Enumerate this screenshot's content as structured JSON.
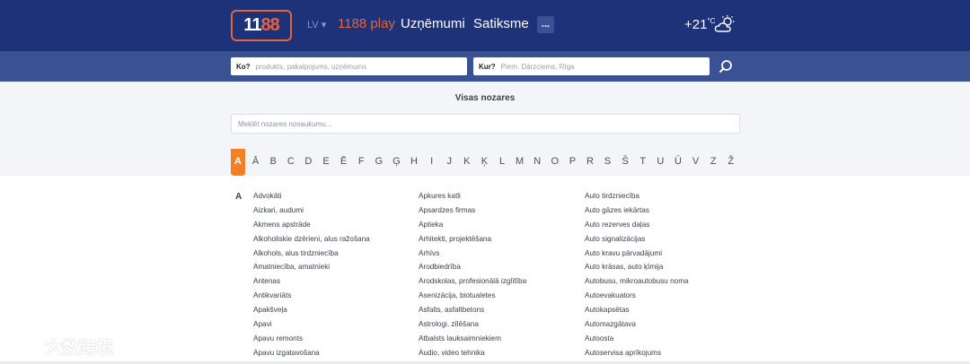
{
  "header": {
    "logo_part1": "11",
    "logo_part2": "88",
    "lang": "LV ▾",
    "nav": {
      "play": "1188 play",
      "companies": "Uzņēmumi",
      "contacts": "Satiksme",
      "more": "..."
    },
    "weather": {
      "temp": "+21",
      "unit": "°C",
      "icon": "cloud-sun-icon"
    }
  },
  "search": {
    "who_label": "Ko?",
    "who_placeholder": "produkts, pakalpojums, uzņēmums",
    "where_label": "Kur?",
    "where_placeholder": "Piem. Dārzciems, Rīga"
  },
  "main": {
    "title": "Visas nozares",
    "filter_placeholder": "Meklēt nozares nosaukumu...",
    "alphabet": [
      "A",
      "Ā",
      "B",
      "C",
      "D",
      "E",
      "Ē",
      "F",
      "G",
      "Ģ",
      "H",
      "I",
      "J",
      "K",
      "Ķ",
      "L",
      "M",
      "N",
      "O",
      "P",
      "R",
      "S",
      "Š",
      "T",
      "U",
      "Ū",
      "V",
      "Z",
      "Ž"
    ],
    "active_letter_index": 0,
    "group_letter": "A",
    "columns": [
      [
        "Advokāti",
        "Aizkari, audumi",
        "Akmens apstrāde",
        "Alkoholiskie dzērieni, alus ražošana",
        "Alkohols, alus tirdzniecība",
        "Amatniecība, amatnieki",
        "Antenas",
        "Antikvariāts",
        "Apakšveļa",
        "Apavi",
        "Apavu remonts",
        "Apavu izgatavošana"
      ],
      [
        "Apkures katli",
        "Apsardzes firmas",
        "Aptieka",
        "Arhitekti, projektēšana",
        "Arhīvs",
        "Arodbiedrība",
        "Arodskolas, profesionālā izglītība",
        "Asenizācija, biotualetes",
        "Asfalts, asfaltbetons",
        "Astrologi, zīlēšana",
        "Atbalsts lauksaimniekiem",
        "Audio, video tehnika"
      ],
      [
        "Auto tirdzniecība",
        "Auto gāzes iekārtas",
        "Auto rezerves daļas",
        "Auto signalizācijas",
        "Auto kravu pārvadājumi",
        "Auto krāsas, auto ķīmija",
        "Autobusu, mikroautobusu noma",
        "Autoevakuators",
        "Autokapsētas",
        "Automazgātava",
        "Autoosta",
        "Autoservisa aprīkojums"
      ]
    ]
  },
  "watermark": {
    "text": "大数跨境"
  }
}
